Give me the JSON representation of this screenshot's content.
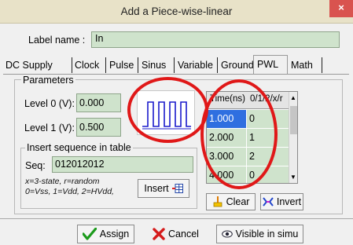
{
  "window": {
    "title": "Add a Piece-wise-linear",
    "close_label": "×"
  },
  "label_field": {
    "label": "Label name :",
    "value": "In"
  },
  "tabs": [
    {
      "label": "DC Supply"
    },
    {
      "label": "Clock"
    },
    {
      "label": "Pulse"
    },
    {
      "label": "Sinus"
    },
    {
      "label": "Variable"
    },
    {
      "label": "Ground"
    },
    {
      "label": "PWL",
      "active": true
    },
    {
      "label": "Math"
    }
  ],
  "parameters": {
    "title": "Parameters",
    "level0": {
      "label": "Level 0 (V):",
      "value": "0.000"
    },
    "level1": {
      "label": "Level 1 (V):",
      "value": "0.500"
    }
  },
  "insert": {
    "title": "Insert sequence in table",
    "seq_label": "Seq:",
    "seq_value": "012012012",
    "hint_line1": "x=3-state, r=random",
    "hint_line2": "0=Vss, 1=Vdd, 2=HVdd,",
    "insert_button": "Insert"
  },
  "table": {
    "headers": [
      "Time(ns)",
      "0/1/2/x/r"
    ],
    "rows": [
      [
        "1.000",
        "0"
      ],
      [
        "2.000",
        "1"
      ],
      [
        "3.000",
        "2"
      ],
      [
        "4.000",
        "0"
      ]
    ]
  },
  "actions": {
    "clear": "Clear",
    "invert": "Invert"
  },
  "footer": {
    "assign": "Assign",
    "cancel": "Cancel",
    "visible": "Visible in simu"
  },
  "colors": {
    "field_green": "#cfe3cc",
    "selection_blue": "#2f6fe0",
    "annotation_red": "#e01818"
  }
}
